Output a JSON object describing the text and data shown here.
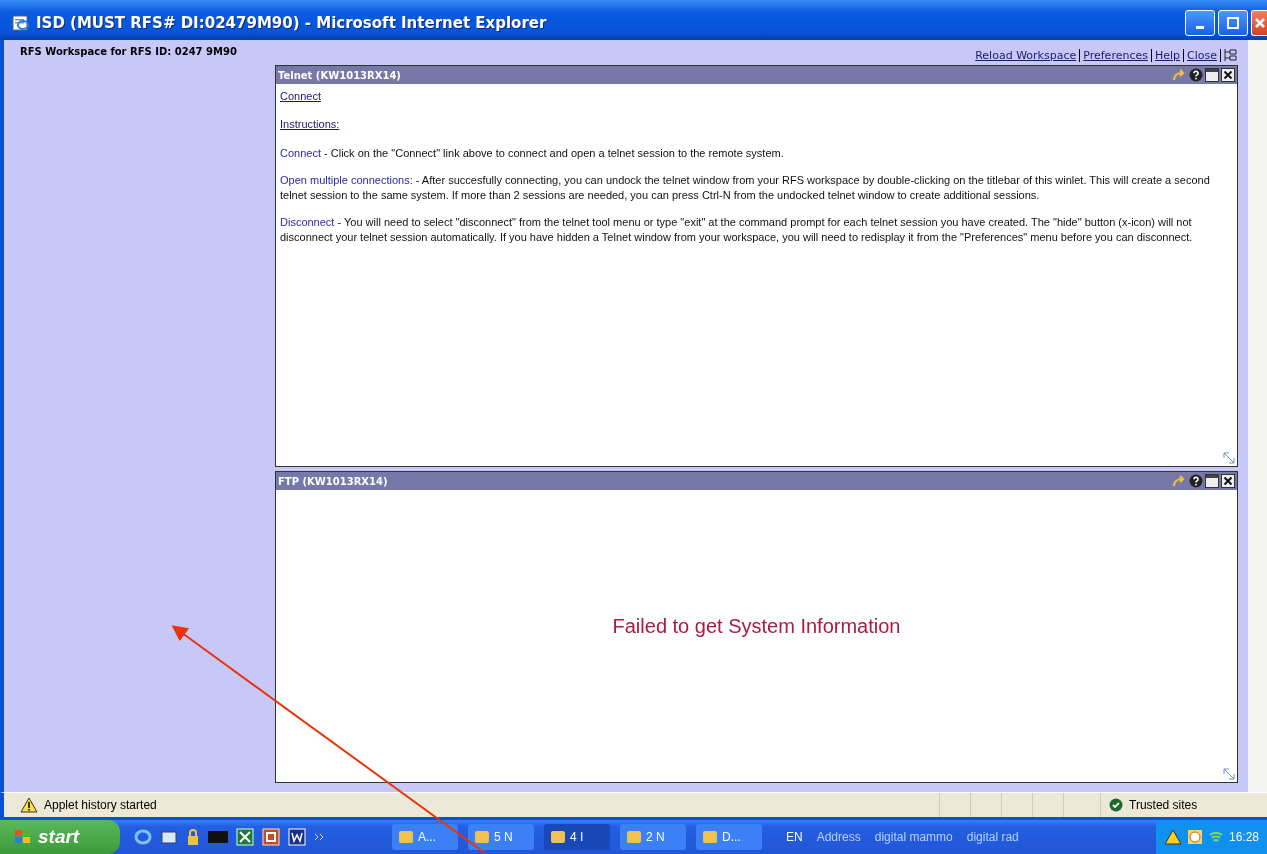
{
  "window": {
    "title": "ISD (MUST RFS# DI:02479M90) - Microsoft Internet Explorer"
  },
  "workspace": {
    "heading": "RFS Workspace for RFS ID: 0247 9M90",
    "links": [
      "Reload Workspace",
      "Preferences",
      "Help",
      "Close"
    ]
  },
  "winlets": [
    {
      "kind": "instructions",
      "title": "Telnet (KW1013RX14)",
      "connect_link": "Connect",
      "instructions_heading": "Instructions:",
      "paragraphs": [
        {
          "term": "Connect",
          "text": " - Click on the \"Connect\" link above to connect and open a telnet session to the remote system."
        },
        {
          "term": "Open multiple connections:",
          "text": " - After succesfully connecting, you can undock the telnet window from your RFS workspace by double-clicking on the titlebar of this winlet. This will create a second telnet session to the same system. If more than 2 sessions are needed, you can press Ctrl-N from the undocked telnet window to create additional sessions."
        },
        {
          "term": "Disconnect",
          "text": " - You will need to select \"disconnect\" from the telnet tool menu or type \"exit\" at the command prompt for each telnet session you have created. The \"hide\" button (x-icon) will not disconnect your telnet session automatically. If you have hidden a Telnet window from your workspace, you will need to redisplay it from the \"Preferences\" menu before you can disconnect."
        }
      ]
    },
    {
      "kind": "message",
      "title": "FTP (KW1013RX14)",
      "message": "Failed to get System Information"
    }
  ],
  "status_bar": {
    "message": "Applet history started",
    "zone": "Trusted sites"
  },
  "taskbar": {
    "start": "start",
    "tasks": [
      {
        "label": "A...",
        "selected": false
      },
      {
        "label": "5 N",
        "selected": false
      },
      {
        "label": "4 I",
        "selected": true
      },
      {
        "label": "2 N",
        "selected": false
      },
      {
        "label": "D...",
        "selected": false
      }
    ],
    "language": "EN",
    "toolbars": [
      "Address",
      "digital mammo",
      "digital rad"
    ],
    "clock": "16:28"
  }
}
